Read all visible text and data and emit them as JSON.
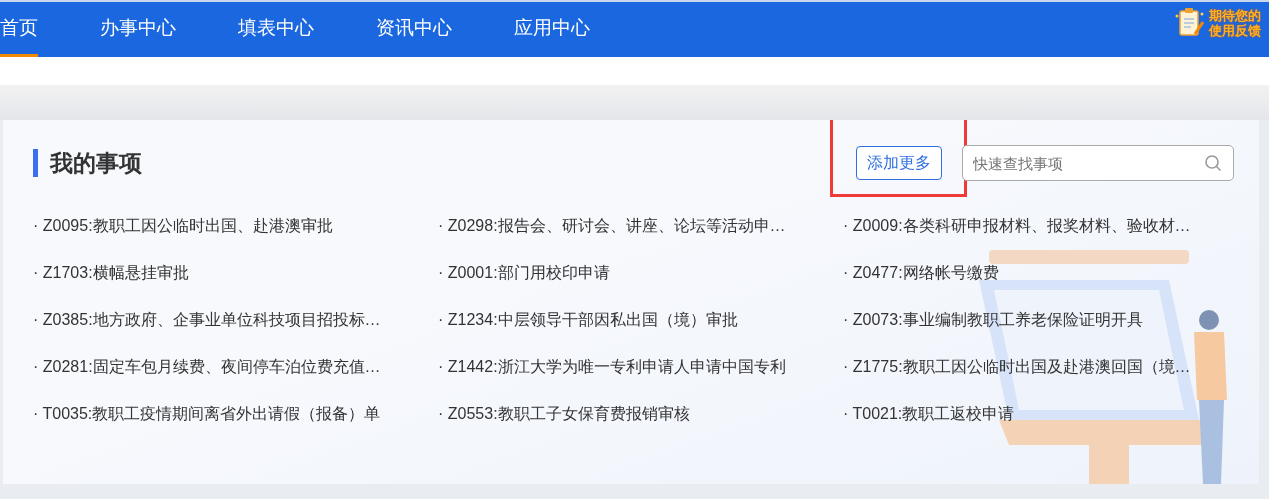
{
  "nav": {
    "tabs": [
      {
        "label": "首页",
        "selected": true
      },
      {
        "label": "办事中心",
        "selected": false
      },
      {
        "label": "填表中心",
        "selected": false
      },
      {
        "label": "资讯中心",
        "selected": false
      },
      {
        "label": "应用中心",
        "selected": false
      }
    ],
    "feedback": {
      "lines": [
        "期待您的",
        "使用反馈"
      ]
    }
  },
  "panel": {
    "title": "我的事项",
    "add_button": "添加更多",
    "search": {
      "placeholder": "快速查找事项"
    },
    "items": [
      {
        "label": "· Z0095:教职工因公临时出国、赴港澳审批"
      },
      {
        "label": "· Z0298:报告会、研讨会、讲座、论坛等活动申…"
      },
      {
        "label": "· Z0009:各类科研申报材料、报奖材料、验收材…"
      },
      {
        "label": "· Z1703:横幅悬挂审批"
      },
      {
        "label": "· Z0001:部门用校印申请"
      },
      {
        "label": "· Z0477:网络帐号缴费"
      },
      {
        "label": "· Z0385:地方政府、企事业单位科技项目招投标…"
      },
      {
        "label": "· Z1234:中层领导干部因私出国（境）审批"
      },
      {
        "label": "· Z0073:事业编制教职工养老保险证明开具"
      },
      {
        "label": "· Z0281:固定车包月续费、夜间停车泊位费充值…"
      },
      {
        "label": "· Z1442:浙江大学为唯一专利申请人申请中国专利"
      },
      {
        "label": "· Z1775:教职工因公临时出国及赴港澳回国（境…"
      },
      {
        "label": "· T0035:教职工疫情期间离省外出请假（报备）单"
      },
      {
        "label": "· Z0553:教职工子女保育费报销审核"
      },
      {
        "label": "· T0021:教职工返校申请"
      }
    ]
  }
}
